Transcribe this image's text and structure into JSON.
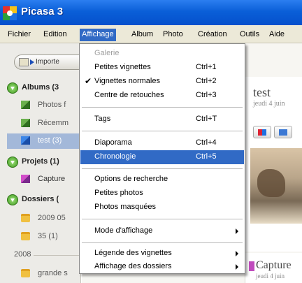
{
  "window": {
    "title": "Picasa 3"
  },
  "menubar": {
    "items": [
      "Fichier",
      "Edition",
      "Affichage",
      "Album",
      "Photo",
      "Création",
      "Outils",
      "Aide"
    ]
  },
  "toolbar": {
    "import_label": "Importe"
  },
  "sidebar": {
    "albums_header": "Albums (3",
    "albums": [
      {
        "label": "Photos f"
      },
      {
        "label": "Récemm"
      },
      {
        "label": "test (3)"
      }
    ],
    "projects_header": "Projets (1)",
    "projects": [
      {
        "label": "Capture"
      }
    ],
    "folders_header": "Dossiers (",
    "folders": [
      {
        "label": "2009 05"
      },
      {
        "label": "35 (1)"
      }
    ],
    "year_label": "2008",
    "folders_2008": [
      {
        "label": "grande s"
      }
    ]
  },
  "content": {
    "album_title": "test",
    "album_date": "jeudi 4 juin",
    "album2_title": "Capture",
    "album2_date": "jeudi 4 juin"
  },
  "dropdown": {
    "items": [
      {
        "label": "Galerie",
        "shortcut": ""
      },
      {
        "label": "Petites vignettes",
        "shortcut": "Ctrl+1"
      },
      {
        "label": "Vignettes normales",
        "shortcut": "Ctrl+2"
      },
      {
        "label": "Centre de retouches",
        "shortcut": "Ctrl+3"
      },
      {
        "label": "Tags",
        "shortcut": "Ctrl+T"
      },
      {
        "label": "Diaporama",
        "shortcut": "Ctrl+4"
      },
      {
        "label": "Chronologie",
        "shortcut": "Ctrl+5"
      },
      {
        "label": "Options de recherche",
        "shortcut": ""
      },
      {
        "label": "Petites photos",
        "shortcut": ""
      },
      {
        "label": "Photos masquées",
        "shortcut": ""
      },
      {
        "label": "Mode d'affichage",
        "shortcut": ""
      },
      {
        "label": "Légende des vignettes",
        "shortcut": ""
      },
      {
        "label": "Affichage des dossiers",
        "shortcut": ""
      }
    ]
  },
  "colors": {
    "titlebar": "#0a5fd8",
    "menu_highlight": "#316ac5",
    "selection": "#a3b8d9"
  }
}
